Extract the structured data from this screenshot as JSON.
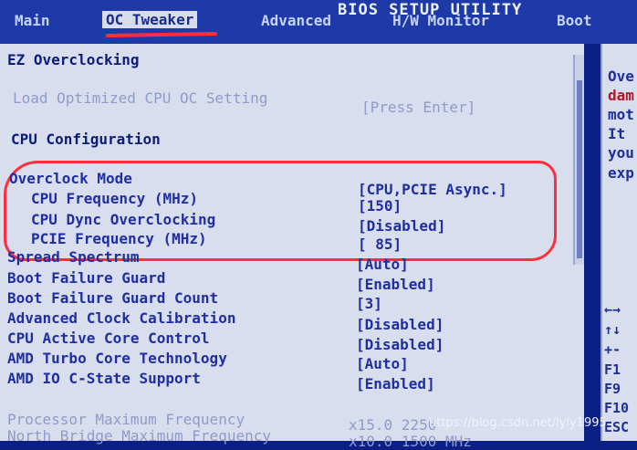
{
  "header": {
    "title": "BIOS SETUP UTILITY",
    "tabs": [
      {
        "label": "Main"
      },
      {
        "label": "OC Tweaker"
      },
      {
        "label": "Advanced"
      },
      {
        "label": "H/W Monitor"
      },
      {
        "label": "Boot"
      }
    ]
  },
  "main": {
    "ez_heading": "EZ Overclocking",
    "load_oc_label": "Load Optimized CPU OC Setting",
    "load_oc_value": "[Press Enter]",
    "cpu_heading": "CPU Configuration",
    "settings": [
      {
        "label": "Overclock Mode",
        "value": "[CPU,PCIE Async.]"
      },
      {
        "label": "CPU Frequency (MHz)",
        "value": "[150]"
      },
      {
        "label": "CPU Dync Overclocking",
        "value": "[Disabled]"
      },
      {
        "label": "PCIE Frequency (MHz)",
        "value": "[ 85]"
      },
      {
        "label": "Spread Spectrum",
        "value": "[Auto]"
      },
      {
        "label": "Boot Failure Guard",
        "value": "[Enabled]"
      },
      {
        "label": "Boot Failure Guard Count",
        "value": "[3]"
      },
      {
        "label": "Advanced Clock Calibration",
        "value": "[Disabled]"
      },
      {
        "label": "CPU Active Core Control",
        "value": "[Disabled]"
      },
      {
        "label": "AMD Turbo Core Technology",
        "value": "[Auto]"
      },
      {
        "label": "AMD IO C-State Support",
        "value": "[Enabled]"
      }
    ],
    "info_rows": [
      {
        "label": "Processor Maximum Frequency",
        "value": "x15.0 2250"
      },
      {
        "label": "North Bridge Maximum Frequency",
        "value": "x10.0 1500 MHz"
      }
    ]
  },
  "help": {
    "lines": [
      "Ove",
      "dam",
      "mot",
      "It",
      "you",
      "exp"
    ],
    "red_lines": [
      1
    ],
    "keys": [
      "←→",
      "↑↓",
      "+-",
      "F1",
      "F9",
      "F10",
      "ESC"
    ]
  },
  "watermark": "https://blog.csdn.net/lyly1995"
}
